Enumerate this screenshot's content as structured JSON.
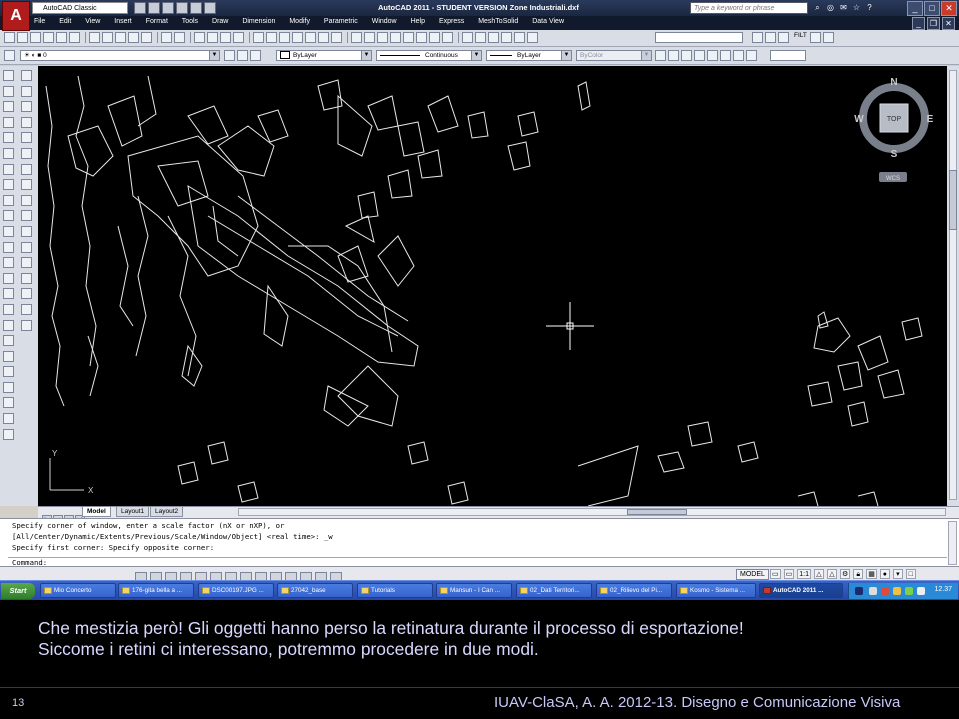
{
  "titlebar": {
    "workspace": "AutoCAD Classic",
    "title": "AutoCAD 2011 - STUDENT VERSION   Zone Industriali.dxf",
    "search_placeholder": "Type a keyword or phrase"
  },
  "menu": [
    "File",
    "Edit",
    "View",
    "Insert",
    "Format",
    "Tools",
    "Draw",
    "Dimension",
    "Modify",
    "Parametric",
    "Window",
    "Help",
    "Express",
    "MeshToSolid",
    "Data View"
  ],
  "properties_bar": {
    "layer": "0",
    "color": "ByLayer",
    "linetype": "Continuous",
    "lineweight": "ByLayer",
    "plotstyle": "ByColor"
  },
  "toolbar_labels": {
    "filt": "FILT"
  },
  "viewcube": {
    "north": "N",
    "south": "S",
    "east": "E",
    "west": "W",
    "top": "TOP",
    "wcs": "WCS"
  },
  "ucs": {
    "y": "Y",
    "x": "X"
  },
  "layout_tabs": [
    "Model",
    "Layout1",
    "Layout2"
  ],
  "command_history": [
    "Specify corner of window, enter a scale factor (nX or nXP), or",
    "[All/Center/Dynamic/Extents/Previous/Scale/Window/Object] <real time>: _w",
    "Specify first corner: Specify opposite corner:"
  ],
  "command_prompt": "Command:",
  "statusbar": {
    "model": "MODEL",
    "scale": "1:1"
  },
  "taskbar": {
    "start": "Start",
    "tasks": [
      "Mio Concerto",
      "176-gita bella a ...",
      "DSC00197.JPG ...",
      "27042_base",
      "Tutorials",
      "Mansun - I Can ...",
      "02_Dati Territori...",
      "02_Rilievo del Pi...",
      "Kosmo - Sistema ...",
      "AutoCAD 2011 ..."
    ],
    "clock": "12.37"
  },
  "slide": {
    "line1": "Che mestizia però! Gli oggetti hanno perso la retinatura durante il processo di esportazione!",
    "line2": "Siccome i retini ci interessano, potremmo procedere in due modi.",
    "page_number": "13",
    "footer": "IUAV-ClaSA, A. A. 2012-13. Disegno e Comunicazione Visiva"
  }
}
